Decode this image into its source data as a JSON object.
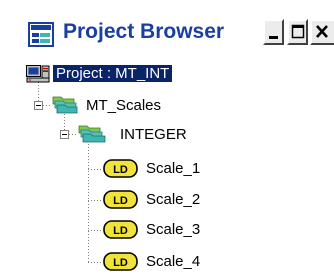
{
  "window": {
    "title": "Project Browser",
    "buttons": {
      "minimize": "_",
      "maximize": "□",
      "close": "×"
    }
  },
  "tree": {
    "root": {
      "label": "Project : MT_INT",
      "icon": "computer-icon",
      "selected": true
    },
    "group": {
      "label": "MT_Scales",
      "icon": "folder-stack-icon",
      "expanded": true
    },
    "subgroup": {
      "label": "INTEGER",
      "icon": "folder-stack-icon",
      "expanded": true
    },
    "ld_badge": "LD",
    "items": [
      {
        "label": "Scale_1",
        "icon": "ld-icon"
      },
      {
        "label": "Scale_2",
        "icon": "ld-icon"
      },
      {
        "label": "Scale_3",
        "icon": "ld-icon"
      },
      {
        "label": "Scale_4",
        "icon": "ld-icon"
      }
    ]
  },
  "colors": {
    "title_text": "#1a3fa0",
    "selection_bg": "#0a246a",
    "ld_badge_fill": "#f2e33a",
    "folder_teal": "#3fb6b0",
    "folder_green": "#7ec850"
  }
}
